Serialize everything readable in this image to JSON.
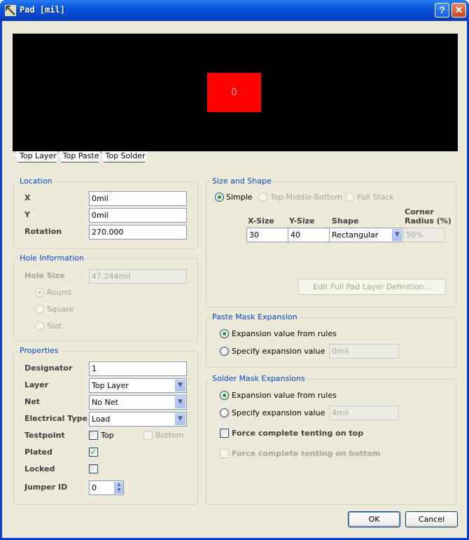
{
  "window": {
    "title": "Pad [mil]",
    "help_glyph": "?",
    "close_glyph": "✕"
  },
  "preview": {
    "pad_label": "0",
    "tabs": [
      "Top Layer",
      "Top Paste",
      "Top Solder"
    ]
  },
  "location": {
    "title": "Location",
    "x_label": "X",
    "x_value": "0mil",
    "y_label": "Y",
    "y_value": "0mil",
    "rotation_label": "Rotation",
    "rotation_value": "270.000"
  },
  "hole": {
    "title": "Hole Information",
    "size_label": "Hole Size",
    "size_value": "47.244mil",
    "round_label": "Round",
    "square_label": "Square",
    "slot_label": "Slot"
  },
  "properties": {
    "title": "Properties",
    "designator_label": "Designator",
    "designator_value": "1",
    "layer_label": "Layer",
    "layer_value": "Top Layer",
    "net_label": "Net",
    "net_value": "No Net",
    "electrical_type_label": "Electrical Type",
    "electrical_type_value": "Load",
    "testpoint_label": "Testpoint",
    "testpoint_top_label": "Top",
    "testpoint_bottom_label": "Bottom",
    "plated_label": "Plated",
    "plated_checked": true,
    "locked_label": "Locked",
    "jumper_label": "Jumper ID",
    "jumper_value": "0"
  },
  "size_shape": {
    "title": "Size and Shape",
    "simple_label": "Simple",
    "tmb_label": "Top-Middle-Bottom",
    "full_stack_label": "Full Stack",
    "x_size_header": "X-Size",
    "y_size_header": "Y-Size",
    "shape_header": "Shape",
    "corner_header_line1": "Corner",
    "corner_header_line2": "Radius (%)",
    "x_size_value": "30",
    "y_size_value": "40",
    "shape_value": "Rectangular",
    "corner_value": "50%",
    "edit_button": "Edit Full Pad Layer Definition..."
  },
  "paste_mask": {
    "title": "Paste Mask Expansion",
    "from_rules_label": "Expansion value from rules",
    "specify_label": "Specify expansion value",
    "specify_value": "0mil"
  },
  "solder_mask": {
    "title": "Solder Mask Expansions",
    "from_rules_label": "Expansion value from rules",
    "specify_label": "Specify expansion value",
    "specify_value": "4mil",
    "tent_top_label": "Force complete tenting on top",
    "tent_bottom_label": "Force complete tenting on bottom"
  },
  "footer": {
    "ok_label": "OK",
    "cancel_label": "Cancel"
  },
  "colors": {
    "titlebar": "#0855dd",
    "dialog_bg": "#ece9d8",
    "group_title": "#0046d5",
    "pad_fill": "#ff0000"
  }
}
